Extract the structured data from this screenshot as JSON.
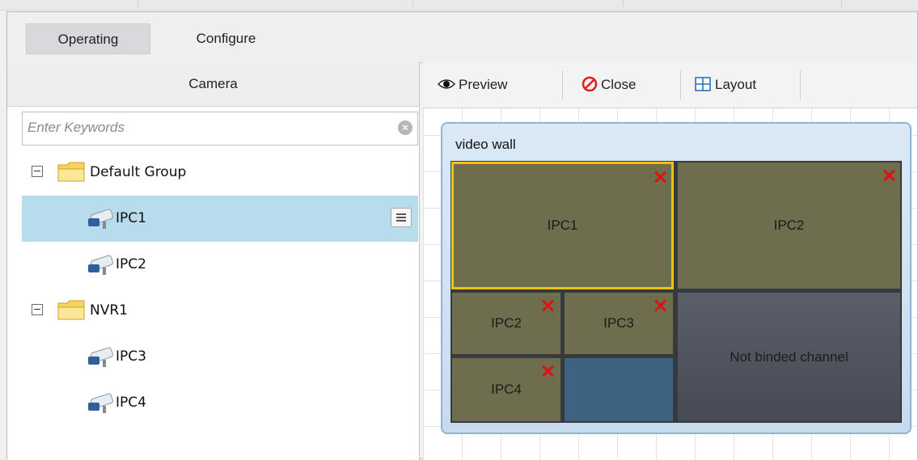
{
  "tabs": {
    "operating": "Operating",
    "configure": "Configure"
  },
  "camera_panel": {
    "title": "Camera",
    "search_placeholder": "Enter Keywords",
    "tree": {
      "group1": "Default Group",
      "group1_items": [
        "IPC1",
        "IPC2"
      ],
      "group2": "NVR1",
      "group2_items": [
        "IPC3",
        "IPC4"
      ]
    }
  },
  "toolbar": {
    "preview": "Preview",
    "close": "Close",
    "layout": "Layout"
  },
  "video_wall": {
    "title": "video wall",
    "cells": {
      "top_left": "IPC1",
      "top_right": "IPC2",
      "mid_left": "IPC2",
      "mid_mid": "IPC3",
      "bottom_left": "IPC4",
      "unbound": "Not binded channel"
    }
  },
  "colors": {
    "selected_row": "#b7dceb",
    "selected_cell_border": "#f1c300",
    "close_mark": "#e01010"
  },
  "icons": [
    "clear-search-icon",
    "expand-collapse-icon",
    "folder-icon",
    "camera-icon",
    "list-menu-icon",
    "eye-icon",
    "no-entry-icon",
    "grid-layout-icon",
    "close-x-icon"
  ]
}
